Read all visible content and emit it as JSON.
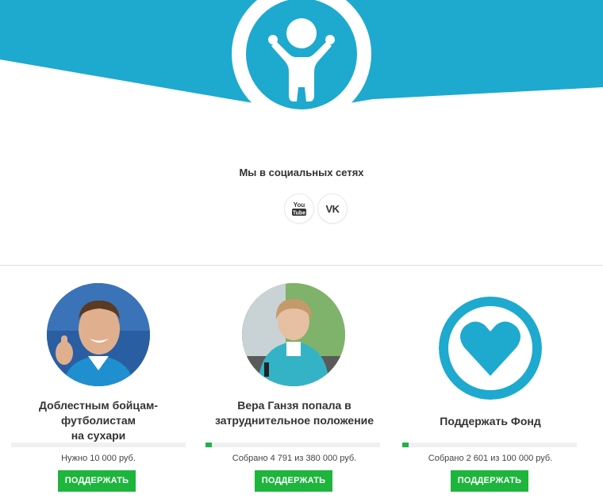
{
  "colors": {
    "brand_blue": "#1ea9cf",
    "progress_green": "#22b14c",
    "button_green": "#1db53c"
  },
  "social": {
    "title": "Мы в социальных сетях",
    "items": [
      {
        "icon": "youtube-icon",
        "label_top": "You",
        "label_bottom": "Tube"
      },
      {
        "icon": "vk-icon",
        "label": "VK"
      }
    ]
  },
  "cards": [
    {
      "title_line1": "Доблестным бойцам-футболистам",
      "title_line2": "на сухари",
      "amount": "Нужно 10 000 руб.",
      "progress": 0.0,
      "button": "ПОДДЕРЖАТЬ"
    },
    {
      "title_line1": "Вера Ганзя попала в",
      "title_line2": "затруднительное положение",
      "amount": "Собрано 4 791 из 380 000 руб.",
      "progress": 0.0126,
      "button": "ПОДДЕРЖАТЬ"
    },
    {
      "title_line1": "Поддержать Фонд",
      "amount": "Собрано 2 601 из 100 000 руб.",
      "progress": 0.026,
      "button": "ПОДДЕРЖАТЬ"
    }
  ]
}
